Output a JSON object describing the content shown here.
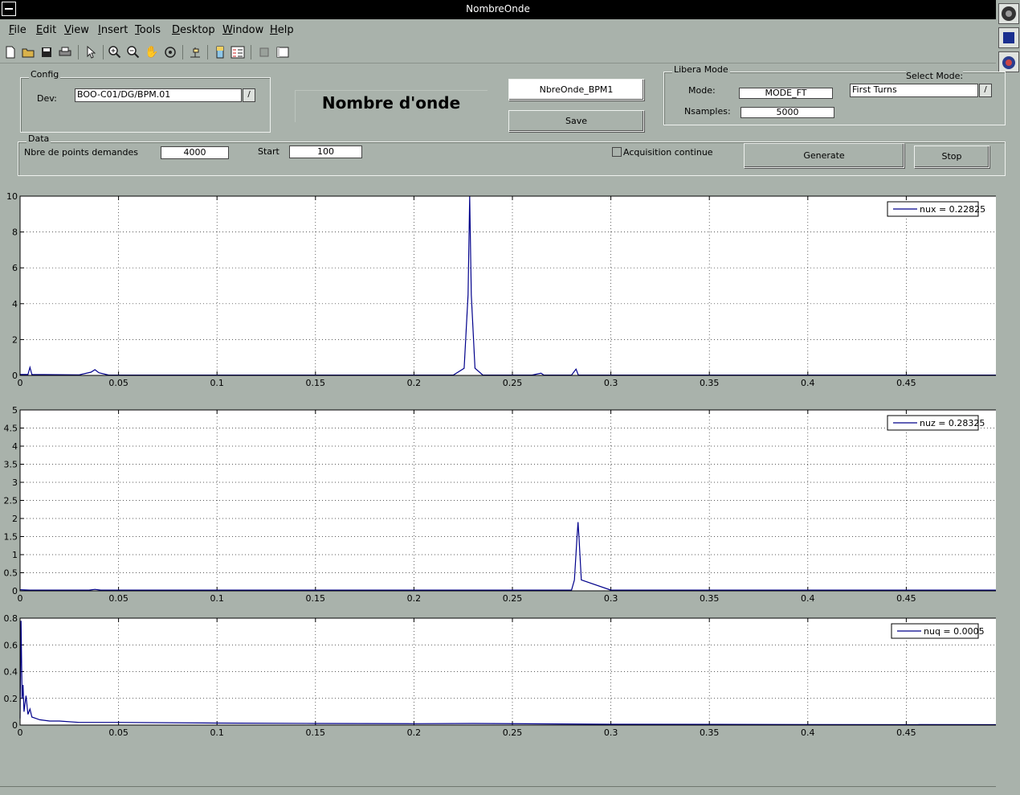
{
  "window": {
    "title": "NombreOnde"
  },
  "menu": [
    "File",
    "Edit",
    "View",
    "Insert",
    "Tools",
    "Desktop",
    "Window",
    "Help"
  ],
  "config": {
    "group_label": "Config",
    "dev_label": "Dev:",
    "dev_value": "BOO-C01/DG/BPM.01"
  },
  "header_title": "Nombre d'onde",
  "name_box": "NbreOnde_BPM1",
  "save_label": "Save",
  "libera": {
    "group_label": "Libera Mode",
    "mode_label": "Mode:",
    "mode_value": "MODE_FT",
    "nsamples_label": "Nsamples:",
    "nsamples_value": "5000",
    "select_mode_label": "Select Mode:",
    "select_mode_value": "First Turns"
  },
  "data_group": {
    "group_label": "Data",
    "points_label": "Nbre de points demandes",
    "points_value": "4000",
    "start_label": "Start",
    "start_value": "100",
    "acq_label": "Acquisition continue",
    "generate_label": "Generate",
    "stop_label": "Stop"
  },
  "chart_data": [
    {
      "type": "line",
      "xlim": [
        0,
        0.5
      ],
      "ylim": [
        0,
        10
      ],
      "xticks": [
        "0",
        "0.05",
        "0.1",
        "0.15",
        "0.2",
        "0.25",
        "0.3",
        "0.35",
        "0.4",
        "0.45",
        "0.5"
      ],
      "yticks": [
        "0",
        "2",
        "4",
        "6",
        "8",
        "10"
      ],
      "grid": true,
      "legend_position": "top-right",
      "series": [
        {
          "name": "nux = 0.22825",
          "color": "#00008b",
          "x": [
            0,
            0.004,
            0.005,
            0.006,
            0.03,
            0.036,
            0.038,
            0.04,
            0.045,
            0.22,
            0.2255,
            0.2275,
            0.2283,
            0.2291,
            0.231,
            0.235,
            0.26,
            0.2645,
            0.266,
            0.28,
            0.2823,
            0.2835,
            0.3,
            0.5
          ],
          "y": [
            0.05,
            0.05,
            0.45,
            0.05,
            0.03,
            0.18,
            0.32,
            0.15,
            0.02,
            0.02,
            0.4,
            4.5,
            10,
            4.5,
            0.4,
            0.02,
            0.02,
            0.12,
            0.02,
            0.02,
            0.35,
            0.02,
            0.02,
            0.02
          ]
        }
      ]
    },
    {
      "type": "line",
      "xlim": [
        0,
        0.5
      ],
      "ylim": [
        0,
        5
      ],
      "xticks": [
        "0",
        "0.05",
        "0.1",
        "0.15",
        "0.2",
        "0.25",
        "0.3",
        "0.35",
        "0.4",
        "0.45",
        "0.5"
      ],
      "yticks": [
        "0",
        "0.5",
        "1",
        "1.5",
        "2",
        "2.5",
        "3",
        "3.5",
        "4",
        "4.5",
        "5"
      ],
      "grid": true,
      "legend_position": "top-right",
      "series": [
        {
          "name": "nuz = 0.28325",
          "color": "#00008b",
          "x": [
            0,
            0.005,
            0.035,
            0.038,
            0.041,
            0.28,
            0.2815,
            0.2827,
            0.2833,
            0.2839,
            0.285,
            0.3,
            0.5
          ],
          "y": [
            0.03,
            0.02,
            0.02,
            0.04,
            0.02,
            0.02,
            0.3,
            1.4,
            1.9,
            1.4,
            0.3,
            0.02,
            0.02
          ]
        }
      ]
    },
    {
      "type": "line",
      "xlim": [
        0,
        0.5
      ],
      "ylim": [
        0,
        0.8
      ],
      "xticks": [
        "0",
        "0.05",
        "0.1",
        "0.15",
        "0.2",
        "0.25",
        "0.3",
        "0.35",
        "0.4",
        "0.45",
        "0.5"
      ],
      "yticks": [
        "0",
        "0.2",
        "0.4",
        "0.6",
        "0.8"
      ],
      "grid": true,
      "legend_position": "top-right",
      "series": [
        {
          "name": "nuq = 0.0005",
          "color": "#00008b",
          "x": [
            0,
            0.0005,
            0.001,
            0.0015,
            0.002,
            0.003,
            0.004,
            0.005,
            0.006,
            0.008,
            0.01,
            0.015,
            0.02,
            0.03,
            0.05,
            0.1,
            0.15,
            0.2,
            0.23,
            0.3,
            0.4,
            0.5
          ],
          "y": [
            0.05,
            0.78,
            0.2,
            0.3,
            0.1,
            0.22,
            0.08,
            0.12,
            0.06,
            0.05,
            0.04,
            0.03,
            0.03,
            0.02,
            0.02,
            0.015,
            0.012,
            0.01,
            0.012,
            0.006,
            0.004,
            0.003
          ]
        }
      ]
    }
  ]
}
